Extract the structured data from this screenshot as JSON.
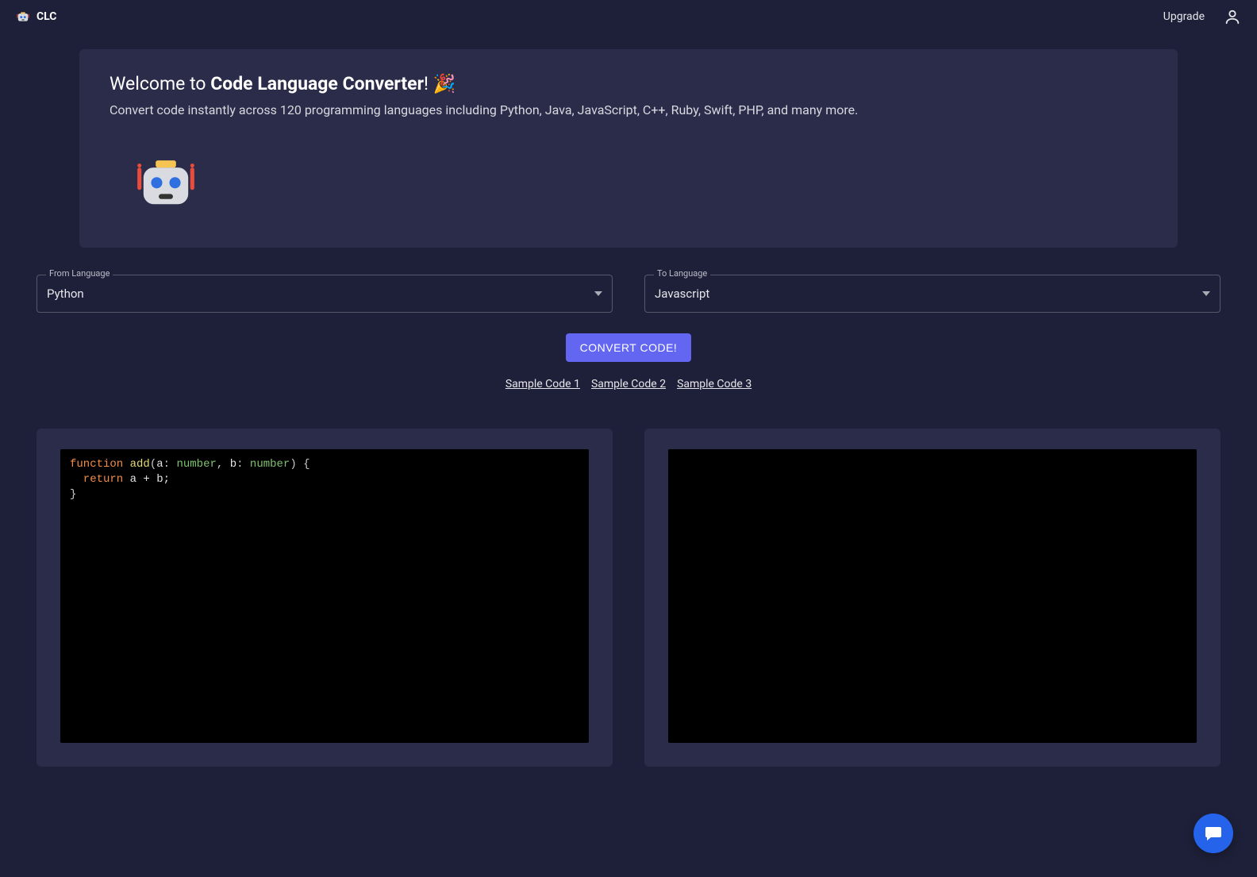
{
  "header": {
    "brand": "CLC",
    "upgrade": "Upgrade"
  },
  "welcome": {
    "prefix": "Welcome to ",
    "strong": "Code Language Converter",
    "suffix": "! 🎉",
    "subtitle": "Convert code instantly across 120 programming languages including Python, Java, JavaScript, C++, Ruby, Swift, PHP, and many more."
  },
  "selectors": {
    "from_label": "From Language",
    "from_value": "Python",
    "to_label": "To Language",
    "to_value": "Javascript"
  },
  "actions": {
    "convert_label": "CONVERT CODE!"
  },
  "samples": {
    "s1": "Sample Code 1",
    "s2": "Sample Code 2",
    "s3": "Sample Code 3"
  },
  "code": {
    "input_tokens": {
      "kw_function": "function",
      "fn_name": "add",
      "lparen": "(",
      "a": "a",
      "colon1": ": ",
      "type1": "number",
      "comma": ", ",
      "b": "b",
      "colon2": ": ",
      "type2": "number",
      "rparen_brace": ") {",
      "indent_return": "  return",
      "expr": " a + b;",
      "close_brace": "}"
    },
    "output": ""
  }
}
